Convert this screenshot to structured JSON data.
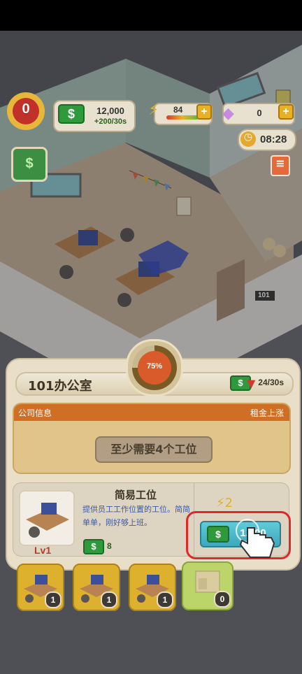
{
  "hud": {
    "level": "0",
    "money": "12,000",
    "money_rate": "+200/30s",
    "energy": "84",
    "gems": "0",
    "timer": "08:28"
  },
  "room": {
    "door_number": "101"
  },
  "panel": {
    "title": "101办公室",
    "rent_rate": "24/30s",
    "progress": "75%",
    "company_info_label": "公司信息",
    "rent_up_label": "租金上涨",
    "requirement": "至少需要4个工位"
  },
  "item": {
    "name": "简易工位",
    "description": "提供员工工作位置的工位。简简单单，刚好够上班。",
    "level": "Lv1",
    "income": "8",
    "energy_cost": "2",
    "price": "1,000"
  },
  "inventory": [
    {
      "count": "1"
    },
    {
      "count": "1"
    },
    {
      "count": "1"
    },
    {
      "count": "0"
    }
  ],
  "icons": {
    "money": "dollar-icon",
    "energy": "lightning-icon",
    "gem": "diamond-icon",
    "timer": "clock-icon",
    "menu": "list-icon",
    "rent_down": "arrow-down-icon",
    "tap": "pointing-hand-icon"
  },
  "colors": {
    "highlight": "#e02828",
    "buy_button": "#4bb8ca",
    "info_header": "#cf6e25"
  }
}
